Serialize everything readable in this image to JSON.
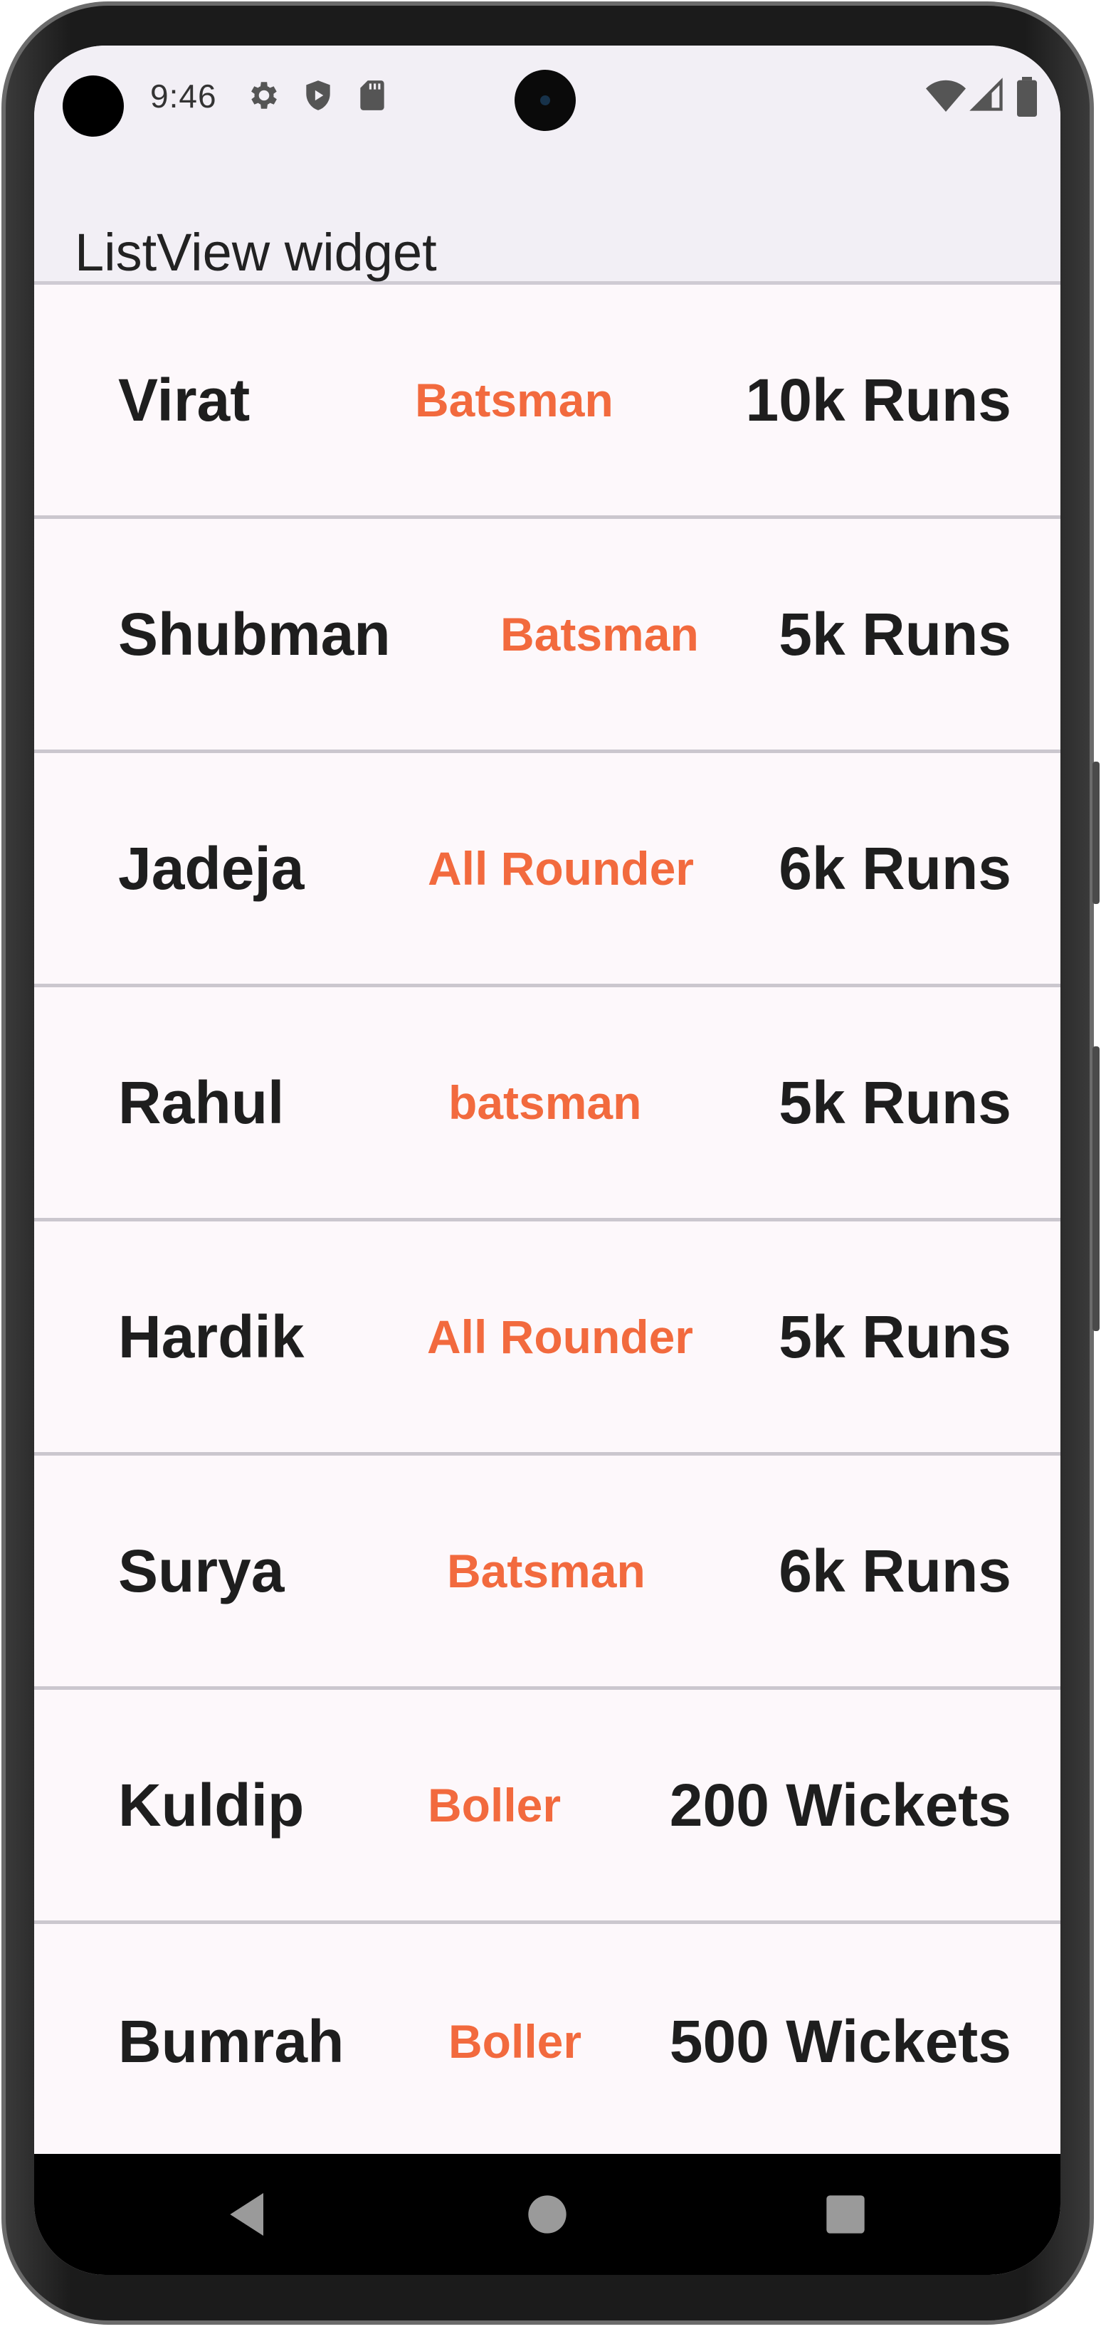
{
  "statusbar": {
    "time": "9:46",
    "left_icons": [
      "gear-icon",
      "shield-icon",
      "sd-card-icon"
    ],
    "right_icons": [
      "wifi-icon",
      "signal-icon",
      "battery-icon"
    ]
  },
  "appbar": {
    "title": "ListView widget"
  },
  "players": [
    {
      "name": "Virat",
      "role": "Batsman",
      "stat": "10k Runs"
    },
    {
      "name": "Shubman",
      "role": "Batsman",
      "stat": "5k Runs"
    },
    {
      "name": "Jadeja",
      "role": "All Rounder",
      "stat": "6k Runs"
    },
    {
      "name": "Rahul",
      "role": "batsman",
      "stat": "5k Runs"
    },
    {
      "name": "Hardik",
      "role": "All Rounder",
      "stat": "5k Runs"
    },
    {
      "name": "Surya",
      "role": "Batsman",
      "stat": "6k Runs"
    },
    {
      "name": "Kuldip",
      "role": "Boller",
      "stat": "200 Wickets"
    },
    {
      "name": "Bumrah",
      "role": "Boller",
      "stat": "500 Wickets"
    }
  ],
  "navbar": {
    "buttons": [
      "back-icon",
      "home-icon",
      "recents-icon"
    ]
  },
  "colors": {
    "role_text": "#f26a3e",
    "primary_text": "#1e1e1e",
    "appbar_bg": "#f2eff5",
    "list_bg": "#fdf8fb"
  }
}
